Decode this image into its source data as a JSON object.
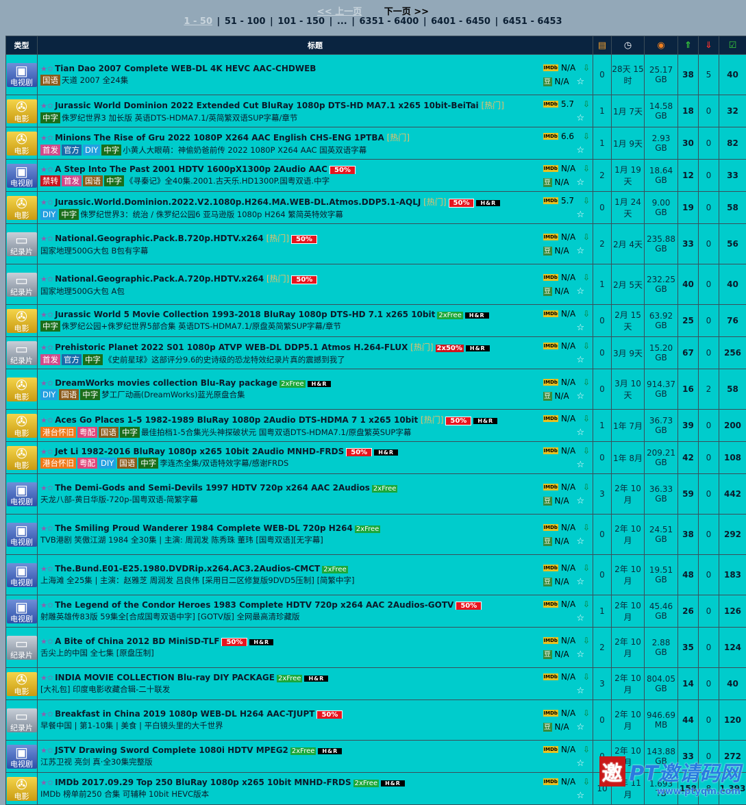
{
  "pager": {
    "prev": "<< 上一页",
    "next": "下一页 >>",
    "current": "1 - 50",
    "pages": [
      "51 - 100",
      "101 - 150",
      "...",
      "6351 - 6400",
      "6401 - 6450",
      "6451 - 6453"
    ]
  },
  "header": {
    "type": "类型",
    "title": "标题"
  },
  "rows": [
    {
      "cat": "电视剧",
      "ico": "tv",
      "title": "Tian Dao 2007 Complete WEB-DL 4K HEVC AAC-CHDWEB",
      "hot": "",
      "pct": "",
      "free": "",
      "hr": "",
      "tags": [
        [
          "国语",
          "gy"
        ]
      ],
      "sub": "天道 2007 全24集",
      "imdb": "N/A",
      "douban": "N/A",
      "com": "0",
      "time": "28天 15时",
      "size": "25.17 GB",
      "seed": "38",
      "leech": "5",
      "done": "40"
    },
    {
      "cat": "电影",
      "ico": "mv",
      "title": "Jurassic World Dominion 2022 Extended Cut BluRay 1080p DTS-HD MA7.1 x265 10bit-BeiTai",
      "hot": "热门",
      "pct": "",
      "free": "",
      "hr": "",
      "tags": [
        [
          "中字",
          "zw"
        ]
      ],
      "sub": "侏罗纪世界3 加长版 英语DTS-HDMA7.1/英简繁双语SUP字幕/章节",
      "imdb": "5.7",
      "douban": "",
      "com": "1",
      "time": "1月 7天",
      "size": "14.58 GB",
      "seed": "18",
      "leech": "0",
      "done": "32"
    },
    {
      "cat": "电影",
      "ico": "mv",
      "title": "Minions The Rise of Gru 2022 1080P X264 AAC English CHS-ENG 1PTBA",
      "hot": "热门",
      "pct": "",
      "free": "",
      "hr": "",
      "tags": [
        [
          "首发",
          "sf"
        ],
        [
          "官方",
          "gf"
        ],
        [
          "DIY",
          "diy"
        ],
        [
          "中字",
          "zw"
        ]
      ],
      "sub": "小黄人大眼萌：神偷奶爸前传 2022 1080P X264 AAC 国英双语字幕",
      "imdb": "6.6",
      "douban": "",
      "com": "1",
      "time": "1月 9天",
      "size": "2.93 GB",
      "seed": "30",
      "leech": "0",
      "done": "82"
    },
    {
      "cat": "电视剧",
      "ico": "tv",
      "title": "A Step Into The Past 2001 HDTV 1600pX1300p 2Audio AAC",
      "hot": "",
      "pct": "50%",
      "free": "",
      "hr": "",
      "tags": [
        [
          "禁转",
          "jz"
        ],
        [
          "首发",
          "sf"
        ],
        [
          "国语",
          "gy"
        ],
        [
          "中字",
          "zw"
        ]
      ],
      "sub": "《寻秦记》全40集.2001.古天乐.HD1300P.国粤双语.中字",
      "imdb": "N/A",
      "douban": "N/A",
      "com": "2",
      "time": "1月 19天",
      "size": "18.64 GB",
      "seed": "12",
      "leech": "0",
      "done": "33"
    },
    {
      "cat": "电影",
      "ico": "mv",
      "title": "Jurassic.World.Dominion.2022.V2.1080p.H264.MA.WEB-DL.Atmos.DDP5.1-AQLJ",
      "hot": "热门",
      "pct": "50%",
      "free": "",
      "hr": "H&R",
      "tags": [
        [
          "DIY",
          "diy"
        ],
        [
          "中字",
          "zw"
        ]
      ],
      "sub": "侏罗纪世界3：统治 / 侏罗纪公园6 亚马逊版 1080p H264 繁简英特效字幕",
      "imdb": "5.7",
      "douban": "",
      "com": "0",
      "time": "1月 24天",
      "size": "9.00 GB",
      "seed": "19",
      "leech": "0",
      "done": "58"
    },
    {
      "cat": "纪录片",
      "ico": "doc",
      "title": "National.Geographic.Pack.B.720p.HDTV.x264",
      "hot": "热门",
      "pct": "50%",
      "free": "",
      "hr": "",
      "tags": [],
      "sub": "国家地理500G大包 B包有字幕",
      "imdb": "N/A",
      "douban": "N/A",
      "com": "2",
      "time": "2月 4天",
      "size": "235.88 GB",
      "seed": "33",
      "leech": "0",
      "done": "56"
    },
    {
      "cat": "纪录片",
      "ico": "doc",
      "title": "National.Geographic.Pack.A.720p.HDTV.x264",
      "hot": "热门",
      "pct": "50%",
      "free": "",
      "hr": "",
      "tags": [],
      "sub": "国家地理500G大包 A包",
      "imdb": "N/A",
      "douban": "N/A",
      "com": "1",
      "time": "2月 5天",
      "size": "232.25 GB",
      "seed": "40",
      "leech": "0",
      "done": "40"
    },
    {
      "cat": "电影",
      "ico": "mv",
      "title": "Jurassic World 5 Movie Collection 1993-2018 BluRay 1080p DTS-HD 7.1 x265 10bit",
      "hot": "",
      "pct": "",
      "free": "2xFree",
      "hr": "H&R",
      "tags": [
        [
          "中字",
          "zw"
        ]
      ],
      "sub": "侏罗纪公园+侏罗纪世界5部合集 英语DTS-HDMA7.1/原盘英简繁SUP字幕/章节",
      "imdb": "N/A",
      "douban": "",
      "com": "0",
      "time": "2月 15天",
      "size": "63.92 GB",
      "seed": "25",
      "leech": "0",
      "done": "76"
    },
    {
      "cat": "纪录片",
      "ico": "doc",
      "title": "Prehistoric Planet 2022 S01 1080p ATVP WEB-DL DDP5.1 Atmos H.264-FLUX",
      "hot": "热门",
      "pct": "",
      "free": "2x50%",
      "hr": "H&R",
      "tags": [
        [
          "首发",
          "sf"
        ],
        [
          "官方",
          "gf"
        ],
        [
          "中字",
          "zw"
        ]
      ],
      "sub": "《史前星球》这部评分9.6的史诗级的恐龙特效纪录片真的震撼到我了",
      "imdb": "N/A",
      "douban": "",
      "com": "0",
      "time": "3月 9天",
      "size": "15.20 GB",
      "seed": "67",
      "leech": "0",
      "done": "256"
    },
    {
      "cat": "电影",
      "ico": "mv",
      "title": "DreamWorks movies collection Blu-Ray package",
      "hot": "",
      "pct": "",
      "free": "2xFree",
      "hr": "H&R",
      "tags": [
        [
          "DIY",
          "diy"
        ],
        [
          "国语",
          "gy"
        ],
        [
          "中字",
          "zw"
        ]
      ],
      "sub": "梦工厂动画(DreamWorks)蓝光原盘合集",
      "imdb": "N/A",
      "douban": "N/A",
      "com": "0",
      "time": "3月 10天",
      "size": "914.37 GB",
      "seed": "16",
      "leech": "2",
      "done": "58"
    },
    {
      "cat": "电影",
      "ico": "mv",
      "title": "Aces Go Places 1-5 1982-1989 BluRay 1080p 2Audio DTS-HDMA 7 1 x265 10bit",
      "hot": "热门",
      "pct": "50%",
      "free": "",
      "hr": "H&R",
      "tags": [
        [
          "港台怀旧",
          "hk"
        ],
        [
          "粤配",
          "yp"
        ],
        [
          "国语",
          "gy"
        ],
        [
          "中字",
          "zw"
        ]
      ],
      "sub": "最佳拍档1-5合集光头神探破状元 国粤双语DTS-HDMA7.1/原盘繁英SUP字幕",
      "imdb": "N/A",
      "douban": "",
      "com": "1",
      "time": "1年 7月",
      "size": "36.73 GB",
      "seed": "39",
      "leech": "0",
      "done": "200"
    },
    {
      "cat": "电影",
      "ico": "mv",
      "title": "Jet Li 1982-2016 BluRay 1080p x265 10bit 2Audio MNHD-FRDS",
      "hot": "",
      "pct": "50%",
      "free": "",
      "hr": "H&R",
      "tags": [
        [
          "港台怀旧",
          "hk"
        ],
        [
          "粤配",
          "yp"
        ],
        [
          "DIY",
          "diy"
        ],
        [
          "国语",
          "gy"
        ],
        [
          "中字",
          "zw"
        ]
      ],
      "sub": "李连杰全集/双语特效字幕/感谢FRDS",
      "imdb": "N/A",
      "douban": "",
      "com": "0",
      "time": "1年 8月",
      "size": "209.21 GB",
      "seed": "42",
      "leech": "0",
      "done": "108"
    },
    {
      "cat": "电视剧",
      "ico": "tv",
      "title": "The Demi-Gods and Semi-Devils 1997 HDTV 720p x264 AAC 2Audios",
      "hot": "",
      "pct": "",
      "free": "2xFree",
      "hr": "",
      "tags": [],
      "sub": "天龙八部-黄日华版-720p-国粤双语-简繁字幕",
      "imdb": "N/A",
      "douban": "N/A",
      "com": "3",
      "time": "2年 10月",
      "size": "36.33 GB",
      "seed": "59",
      "leech": "0",
      "done": "442"
    },
    {
      "cat": "电视剧",
      "ico": "tv",
      "title": "The Smiling Proud Wanderer 1984 Complete WEB-DL 720p H264",
      "hot": "",
      "pct": "",
      "free": "2xFree",
      "hr": "",
      "tags": [],
      "sub": "TVB港剧 笑傲江湖 1984 全30集 | 主演: 周润发 陈秀珠 董玮 [国粤双语][无字幕]",
      "imdb": "N/A",
      "douban": "N/A",
      "com": "0",
      "time": "2年 10月",
      "size": "24.51 GB",
      "seed": "38",
      "leech": "0",
      "done": "292"
    },
    {
      "cat": "电视剧",
      "ico": "tv",
      "title": "The.Bund.E01-E25.1980.DVDRip.x264.AC3.2Audios-CMCT",
      "hot": "",
      "pct": "",
      "free": "2xFree",
      "hr": "",
      "tags": [],
      "sub": "上海滩 全25集 | 主演：赵雅芝 周润发 吕良伟 [采用日二区修复版9DVD5压制] [简繁中字]",
      "imdb": "N/A",
      "douban": "N/A",
      "com": "0",
      "time": "2年 10月",
      "size": "19.51 GB",
      "seed": "48",
      "leech": "0",
      "done": "183"
    },
    {
      "cat": "电视剧",
      "ico": "tv",
      "title": "The Legend of the Condor Heroes 1983 Complete HDTV 720p x264 AAC 2Audios-GOTV",
      "hot": "",
      "pct": "50%",
      "free": "",
      "hr": "",
      "tags": [],
      "sub": "射雕英雄传83版 59集全[合成国粤双语中字] [GOTV版] 全网最高清珍藏版",
      "imdb": "N/A",
      "douban": "",
      "com": "1",
      "time": "2年 10月",
      "size": "45.46 GB",
      "seed": "26",
      "leech": "0",
      "done": "126"
    },
    {
      "cat": "纪录片",
      "ico": "doc",
      "title": "A Bite of China 2012 BD MiniSD-TLF",
      "hot": "",
      "pct": "50%",
      "free": "",
      "hr": "H&R",
      "tags": [],
      "sub": "舌尖上的中国 全七集 [原盘压制]",
      "imdb": "N/A",
      "douban": "N/A",
      "com": "2",
      "time": "2年 10月",
      "size": "2.88 GB",
      "seed": "35",
      "leech": "0",
      "done": "124"
    },
    {
      "cat": "电影",
      "ico": "mv",
      "title": "INDIA MOVIE COLLECTION Blu-ray DIY PACKAGE",
      "hot": "",
      "pct": "",
      "free": "2xFree",
      "hr": "H&R",
      "tags": [],
      "sub": "[大礼包] 印度电影收藏合辑-二十联发",
      "imdb": "N/A",
      "douban": "",
      "com": "3",
      "time": "2年 10月",
      "size": "804.05 GB",
      "seed": "14",
      "leech": "0",
      "done": "40"
    },
    {
      "cat": "纪录片",
      "ico": "doc",
      "title": "Breakfast in China 2019 1080p WEB-DL H264 AAC-TJUPT",
      "hot": "",
      "pct": "50%",
      "free": "",
      "hr": "",
      "tags": [],
      "sub": "早餐中国 | 第1-10集 | 美食 | 平白镜头里的大千世界",
      "imdb": "N/A",
      "douban": "N/A",
      "com": "0",
      "time": "2年 10月",
      "size": "946.69 MB",
      "seed": "44",
      "leech": "0",
      "done": "120"
    },
    {
      "cat": "电视剧",
      "ico": "tv",
      "title": "JSTV Drawing Sword Complete 1080i HDTV MPEG2",
      "hot": "",
      "pct": "",
      "free": "2xFree",
      "hr": "H&R",
      "tags": [],
      "sub": "江苏卫视 亮剑 真·全30集完整版",
      "imdb": "N/A",
      "douban": "",
      "com": "0",
      "time": "2年 10月",
      "size": "143.88 GB",
      "seed": "33",
      "leech": "0",
      "done": "272"
    },
    {
      "cat": "电影",
      "ico": "mv",
      "title": "IMDb 2017.09.29 Top 250 BluRay 1080p x265 10bit MNHD-FRDS",
      "hot": "",
      "pct": "",
      "free": "2xFree",
      "hr": "H&R",
      "tags": [],
      "sub": "IMDb 榜单前250 合集 可辅种 10bit HEVC版本",
      "imdb": "N/A",
      "douban": "",
      "com": "10",
      "time": "2年 11月",
      "size": "1.693 TB",
      "seed": "158",
      "leech": "8",
      "done": "1,393"
    }
  ],
  "watermark": {
    "main": "PT邀请码网",
    "sub": "www.ptyqm.com",
    "seal": "邀"
  }
}
